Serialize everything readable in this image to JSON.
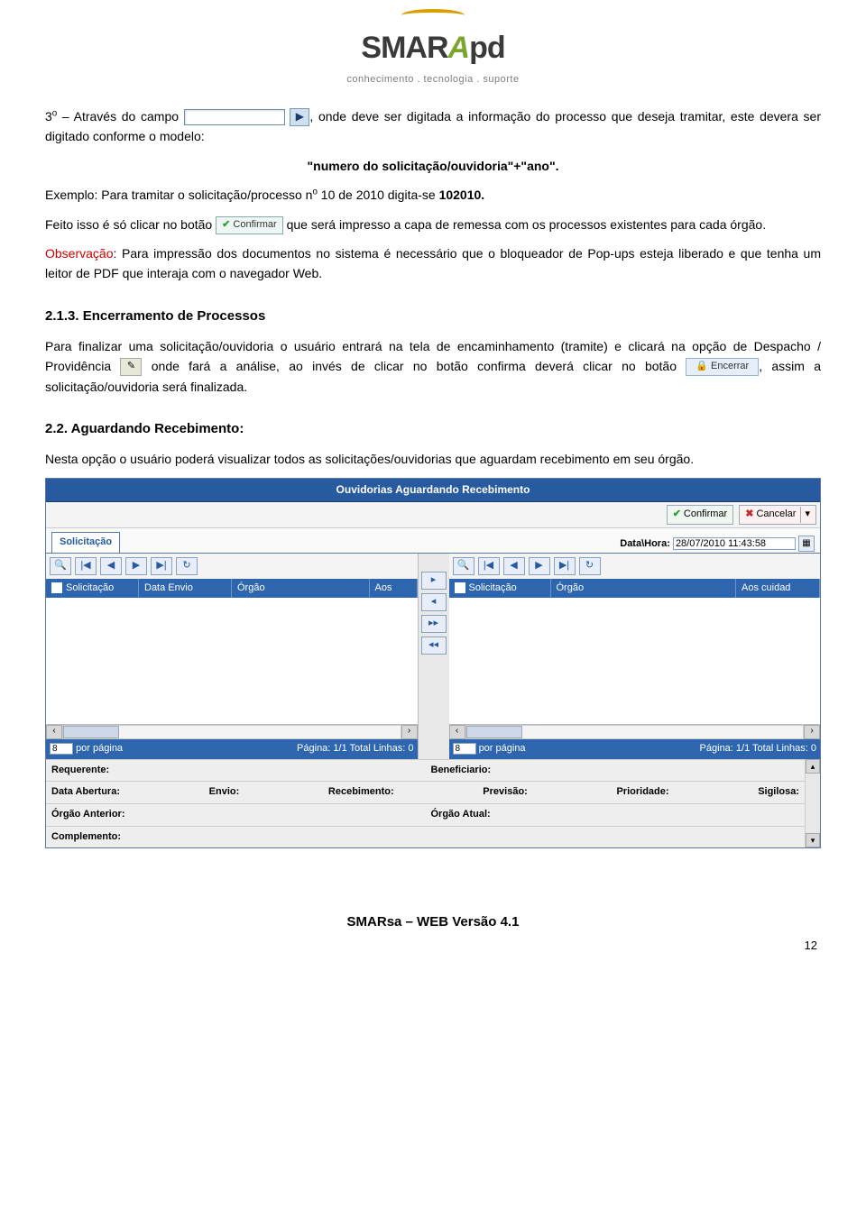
{
  "logo": {
    "brand": "SMARApd",
    "tagline": "conhecimento . tecnologia . suporte"
  },
  "p1_a": "3",
  "p1_sup": "o",
  "p1_b": " – Através do campo ",
  "p1_c": ", onde deve ser digitada a informação do processo que deseja tramitar, este devera ser digitado conforme o modelo:",
  "model_line": "\"numero do solicitação/ouvidoria\"+\"ano\".",
  "p2_a": "Exemplo: Para tramitar o solicitação/processo n",
  "p2_sup": "o",
  "p2_b": " 10 de 2010 digita-se ",
  "p2_bold": "102010.",
  "p3_a": "Feito isso é só clicar no botão ",
  "confirm_label": "Confirmar",
  "p3_b": " que será impresso a capa de remessa com os processos existentes para cada órgão.",
  "obs_label": "Observação",
  "obs_text": ": Para impressão dos documentos no sistema é necessário que o bloqueador de Pop-ups esteja liberado e que tenha um leitor de PDF que interaja com o navegador Web.",
  "sec213_title": "2.1.3. Encerramento de Processos",
  "sec213_a": "Para finalizar uma solicitação/ouvidoria o usuário entrará na tela de encaminhamento (tramite) e clicará na opção de Despacho / Providência ",
  "sec213_b": " onde fará a análise, ao invés de clicar no botão confirma deverá clicar no botão ",
  "encerrar_label": "Encerrar",
  "sec213_c": ", assim a solicitação/ouvidoria será finalizada.",
  "sec22_title": "2.2.  Aguardando Recebimento:",
  "sec22_text": "Nesta opção o usuário poderá visualizar todos as solicitações/ouvidorias que aguardam recebimento em seu órgão.",
  "shot": {
    "title": "Ouvidorias Aguardando Recebimento",
    "confirm": "Confirmar",
    "cancel": "Cancelar",
    "tab": "Solicitação",
    "datahora_label": "Data\\Hora:",
    "datahora_value": "28/07/2010 11:43:58",
    "left_cols": [
      "Solicitação",
      "Data Envio",
      "Órgão",
      "Aos"
    ],
    "right_cols": [
      "Solicitação",
      "Órgão",
      "Aos cuidad"
    ],
    "per_page_value": "8",
    "per_page_label": "por página",
    "page_info": "Página: 1/1 Total Linhas: 0",
    "fields_row1_left": "Requerente:",
    "fields_row1_right": "Beneficiario:",
    "fields_row2": [
      "Data Abertura:",
      "Envio:",
      "Recebimento:",
      "Previsão:",
      "Prioridade:",
      "Sigilosa:"
    ],
    "fields_row3_left": "Órgão Anterior:",
    "fields_row3_right": "Órgão Atual:",
    "fields_row4": "Complemento:"
  },
  "footer": "SMARsa – WEB Versão 4.1",
  "page_number": "12"
}
